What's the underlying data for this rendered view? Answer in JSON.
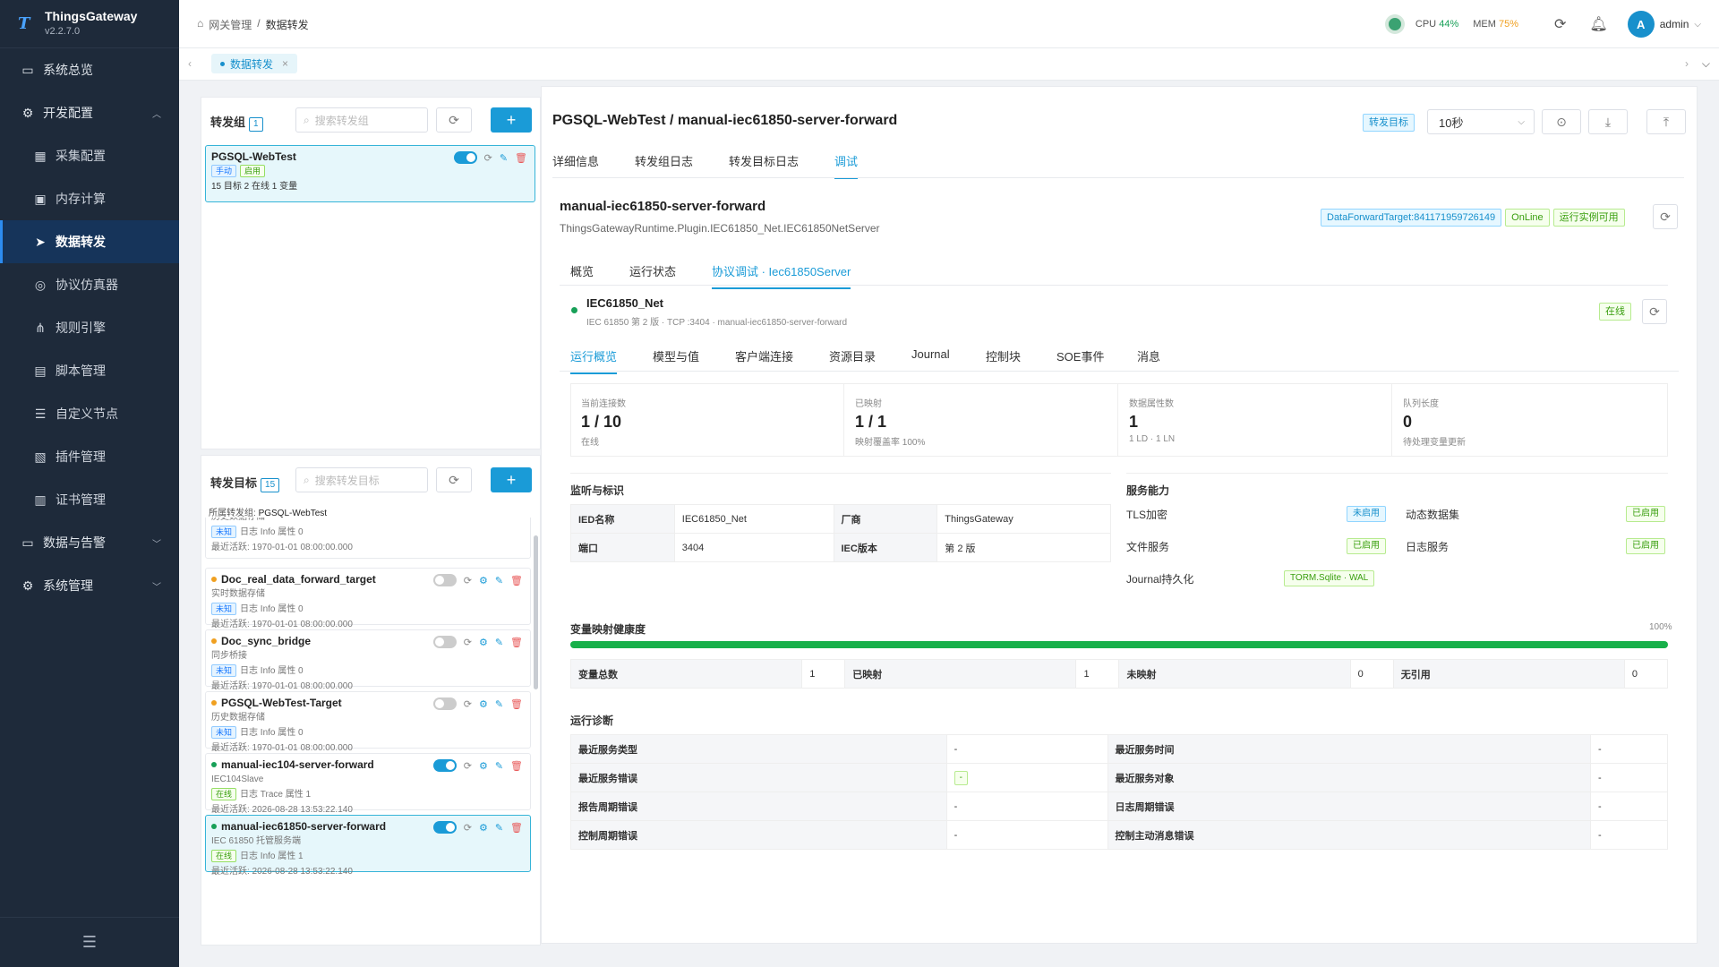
{
  "app": {
    "name": "ThingsGateway",
    "version": "v2.2.7.0"
  },
  "sidebar": {
    "items": [
      {
        "label": "系统总览",
        "icon": "monitor-icon",
        "level": "top"
      },
      {
        "label": "开发配置",
        "icon": "gear-icon",
        "level": "top",
        "expanded": true
      },
      {
        "label": "采集配置",
        "icon": "collect-icon",
        "level": "sub"
      },
      {
        "label": "内存计算",
        "icon": "chip-icon",
        "level": "sub"
      },
      {
        "label": "数据转发",
        "icon": "send-icon",
        "level": "sub",
        "active": true
      },
      {
        "label": "协议仿真器",
        "icon": "simulator-icon",
        "level": "sub"
      },
      {
        "label": "规则引擎",
        "icon": "share-icon",
        "level": "sub"
      },
      {
        "label": "脚本管理",
        "icon": "document-icon",
        "level": "sub"
      },
      {
        "label": "自定义节点",
        "icon": "sliders-icon",
        "level": "sub"
      },
      {
        "label": "插件管理",
        "icon": "plugin-icon",
        "level": "sub"
      },
      {
        "label": "证书管理",
        "icon": "certificate-icon",
        "level": "sub"
      },
      {
        "label": "数据与告警",
        "icon": "alarm-icon",
        "level": "top"
      },
      {
        "label": "系统管理",
        "icon": "settings-icon",
        "level": "top"
      }
    ]
  },
  "header": {
    "breadcrumb": [
      "网关管理",
      "/",
      "数据转发"
    ],
    "cpu_label": "CPU",
    "cpu": "44%",
    "mem_label": "MEM",
    "mem": "75%",
    "user": "admin",
    "avatar": "A"
  },
  "tabbar": {
    "tab": "数据转发"
  },
  "groups": {
    "title": "转发组",
    "count": "1",
    "search_placeholder": "搜索转发组",
    "items": [
      {
        "name": "PGSQL-WebTest",
        "tag1": "手动",
        "tag2": "启用",
        "stats": "15 目标 2 在线 1 变量"
      }
    ]
  },
  "targets": {
    "title": "转发目标",
    "count": "15",
    "search_placeholder": "搜索转发目标",
    "group_label": "所属转发组:",
    "group_value": "PGSQL-WebTest",
    "partial": {
      "desc": "历史数据存储",
      "tag": "未知",
      "info": "日志 Info 属性 0",
      "active": "最近活跃: 1970-01-01 08:00:00.000"
    },
    "items": [
      {
        "name": "Doc_real_data_forward_target",
        "desc": "实时数据存储",
        "tag": "未知",
        "info": "日志 Info 属性 0",
        "active": "最近活跃: 1970-01-01 08:00:00.000",
        "on": false
      },
      {
        "name": "Doc_sync_bridge",
        "desc": "同步桥接",
        "tag": "未知",
        "info": "日志 Info 属性 0",
        "active": "最近活跃: 1970-01-01 08:00:00.000",
        "on": false
      },
      {
        "name": "PGSQL-WebTest-Target",
        "desc": "历史数据存储",
        "tag": "未知",
        "info": "日志 Info 属性 0",
        "active": "最近活跃: 1970-01-01 08:00:00.000",
        "on": false
      },
      {
        "name": "manual-iec104-server-forward",
        "desc": "IEC104Slave",
        "tag": "在线",
        "info": "日志 Trace 属性 1",
        "active": "最近活跃: 2026-08-28 13:53:22.140",
        "on": true
      },
      {
        "name": "manual-iec61850-server-forward",
        "desc": "IEC 61850 托管服务端",
        "tag": "在线",
        "info": "日志 Info 属性 1",
        "active": "最近活跃: 2026-08-28 13:53:22.140",
        "on": true
      }
    ]
  },
  "main": {
    "title": "PGSQL-WebTest / manual-iec61850-server-forward",
    "target_tag": "转发目标",
    "interval": "10秒",
    "tabs": [
      "详细信息",
      "转发组日志",
      "转发目标日志",
      "调试"
    ],
    "target_name": "manual-iec61850-server-forward",
    "target_type": "ThingsGatewayRuntime.Plugin.IEC61850_Net.IEC61850NetServer",
    "badge_id": "DataForwardTarget:841171959726149",
    "badge_online": "OnLine",
    "badge_run": "运行实例可用",
    "subtabs": [
      "概览",
      "运行状态",
      "协议调试 · Iec61850Server"
    ],
    "server_name": "IEC61850_Net",
    "server_meta": "IEC 61850 第 2 版 · TCP :3404 · manual-iec61850-server-forward",
    "server_status": "在线",
    "debug_tabs": [
      "运行概览",
      "模型与值",
      "客户端连接",
      "资源目录",
      "Journal",
      "控制块",
      "SOE事件",
      "消息"
    ],
    "stats": [
      {
        "label": "当前连接数",
        "value": "1 / 10",
        "sub": "在线"
      },
      {
        "label": "已映射",
        "value": "1 / 1",
        "sub": "映射覆盖率 100%"
      },
      {
        "label": "数据属性数",
        "value": "1",
        "sub": "1 LD · 1 LN"
      },
      {
        "label": "队列长度",
        "value": "0",
        "sub": "待处理变量更新"
      }
    ],
    "listen_title": "监听与标识",
    "listen": [
      [
        "IED名称",
        "IEC61850_Net",
        "厂商",
        "ThingsGateway"
      ],
      [
        "端口",
        "3404",
        "IEC版本",
        "第 2 版"
      ]
    ],
    "cap_title": "服务能力",
    "caps": [
      [
        "TLS加密",
        "未启用",
        "动态数据集",
        "已启用"
      ],
      [
        "文件服务",
        "已启用",
        "日志服务",
        "已启用"
      ],
      [
        "Journal持久化",
        "TORM.Sqlite · WAL",
        "",
        ""
      ]
    ],
    "health_title": "变量映射健康度",
    "health_pct": "100%",
    "health_value": 100,
    "health": [
      "变量总数",
      "1",
      "已映射",
      "1",
      "未映射",
      "0",
      "无引用",
      "0"
    ],
    "diag_title": "运行诊断",
    "diag": [
      [
        "最近服务类型",
        "-",
        "最近服务时间",
        "-"
      ],
      [
        "最近服务错误",
        "-",
        "最近服务对象",
        "-"
      ],
      [
        "报告周期错误",
        "-",
        "日志周期错误",
        "-"
      ],
      [
        "控制周期错误",
        "-",
        "控制主动消息错误",
        "-"
      ]
    ]
  }
}
